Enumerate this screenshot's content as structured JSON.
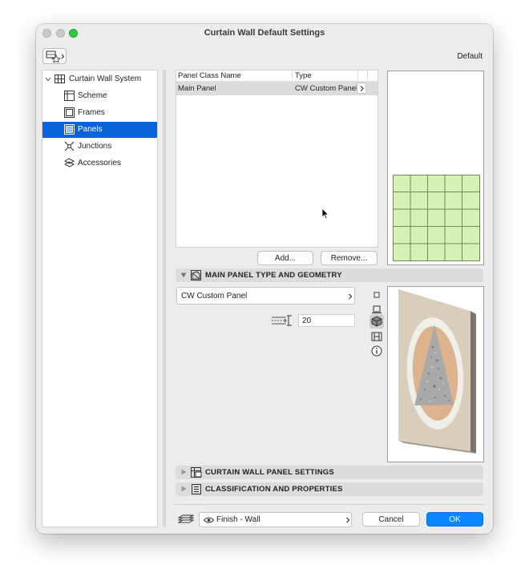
{
  "window": {
    "title": "Curtain Wall Default Settings"
  },
  "header": {
    "default_label": "Default",
    "favorites_icon": "favorites-icon"
  },
  "tree": {
    "root": "Curtain Wall System",
    "items": [
      {
        "label": "Scheme",
        "icon": "scheme-icon"
      },
      {
        "label": "Frames",
        "icon": "frames-icon"
      },
      {
        "label": "Panels",
        "icon": "panels-icon",
        "selected": true
      },
      {
        "label": "Junctions",
        "icon": "junctions-icon"
      },
      {
        "label": "Accessories",
        "icon": "accessories-icon"
      }
    ]
  },
  "panel_table": {
    "columns": [
      "Panel Class Name",
      "Type"
    ],
    "rows": [
      {
        "name": "Main Panel",
        "type": "CW Custom Panel"
      }
    ]
  },
  "buttons": {
    "add": "Add...",
    "remove": "Remove...",
    "cancel": "Cancel",
    "ok": "OK"
  },
  "sections": {
    "geometry": "MAIN PANEL TYPE AND GEOMETRY",
    "settings": "CURTAIN WALL PANEL SETTINGS",
    "classification": "CLASSIFICATION AND PROPERTIES"
  },
  "geometry": {
    "panel_type": "CW Custom Panel",
    "thickness": "20"
  },
  "footer": {
    "layer_value": "Finish - Wall"
  },
  "colors": {
    "accent": "#0a63d8",
    "grid_fill": "#d7f0b5",
    "panel_stone": "#d9cdbc",
    "panel_circle": "#ddb28e"
  }
}
